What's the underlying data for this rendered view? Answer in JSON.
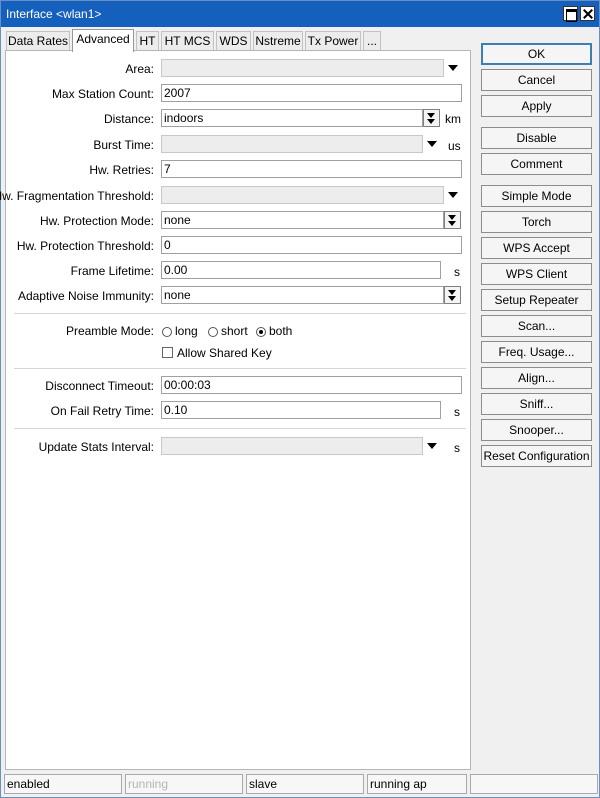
{
  "window": {
    "title": "Interface <wlan1>"
  },
  "tabs": [
    "Data Rates",
    "Advanced",
    "HT",
    "HT MCS",
    "WDS",
    "Nstreme",
    "Tx Power",
    "..."
  ],
  "active_tab": "Advanced",
  "form": {
    "area": {
      "label": "Area:",
      "value": ""
    },
    "max_station_count": {
      "label": "Max Station Count:",
      "value": "2007"
    },
    "distance": {
      "label": "Distance:",
      "value": "indoors",
      "unit": "km"
    },
    "burst_time": {
      "label": "Burst Time:",
      "value": "",
      "unit": "us"
    },
    "hw_retries": {
      "label": "Hw. Retries:",
      "value": "7"
    },
    "hw_frag_threshold": {
      "label": "Hw. Fragmentation Threshold:",
      "value": ""
    },
    "hw_protection_mode": {
      "label": "Hw. Protection Mode:",
      "value": "none"
    },
    "hw_protection_threshold": {
      "label": "Hw. Protection Threshold:",
      "value": "0"
    },
    "frame_lifetime": {
      "label": "Frame Lifetime:",
      "value": "0.00",
      "unit": "s"
    },
    "adaptive_noise_immunity": {
      "label": "Adaptive Noise Immunity:",
      "value": "none"
    },
    "preamble_mode": {
      "label": "Preamble Mode:",
      "options": [
        "long",
        "short",
        "both"
      ],
      "selected": "both"
    },
    "allow_shared_key": {
      "label": "Allow Shared Key",
      "checked": false
    },
    "disconnect_timeout": {
      "label": "Disconnect Timeout:",
      "value": "00:00:03"
    },
    "on_fail_retry_time": {
      "label": "On Fail Retry Time:",
      "value": "0.10",
      "unit": "s"
    },
    "update_stats_interval": {
      "label": "Update Stats Interval:",
      "value": "",
      "unit": "s"
    }
  },
  "buttons": {
    "ok": "OK",
    "cancel": "Cancel",
    "apply": "Apply",
    "disable": "Disable",
    "comment": "Comment",
    "simple_mode": "Simple Mode",
    "torch": "Torch",
    "wps_accept": "WPS Accept",
    "wps_client": "WPS Client",
    "setup_repeater": "Setup Repeater",
    "scan": "Scan...",
    "freq_usage": "Freq. Usage...",
    "align": "Align...",
    "sniff": "Sniff...",
    "snooper": "Snooper...",
    "reset_configuration": "Reset Configuration"
  },
  "status_bar": [
    "enabled",
    "running",
    "slave",
    "running ap",
    ""
  ],
  "icons": {
    "maximize": "maximize-icon",
    "close": "close-icon",
    "dropdown": "dropdown-arrow-icon",
    "updown": "up-down-arrow-icon"
  },
  "colors": {
    "titlebar": "#1560bd",
    "accent_border": "#3c7fb1"
  }
}
